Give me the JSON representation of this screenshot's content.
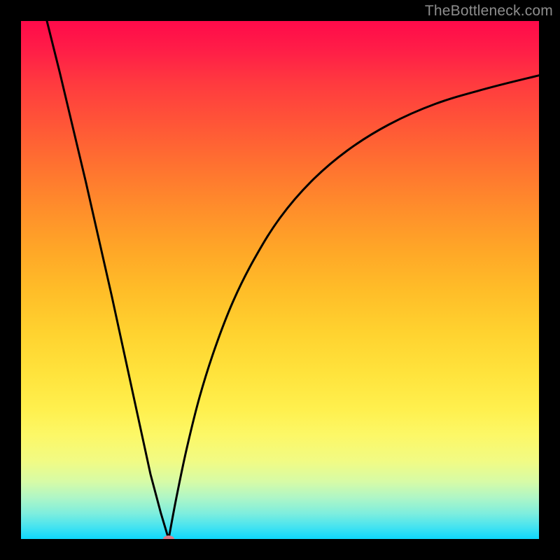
{
  "watermark": "TheBottleneck.com",
  "chart_data": {
    "type": "line",
    "title": "",
    "xlabel": "",
    "ylabel": "",
    "xlim": [
      0,
      1
    ],
    "ylim": [
      0,
      1
    ],
    "minimum": {
      "x": 0.285,
      "y": 0.0
    },
    "left_branch": {
      "x": [
        0.05,
        0.075,
        0.1,
        0.125,
        0.15,
        0.175,
        0.2,
        0.225,
        0.25,
        0.27,
        0.285
      ],
      "y": [
        1.0,
        0.9,
        0.795,
        0.69,
        0.58,
        0.47,
        0.355,
        0.24,
        0.125,
        0.05,
        0.0
      ]
    },
    "right_branch": {
      "x": [
        0.285,
        0.3,
        0.32,
        0.345,
        0.375,
        0.41,
        0.45,
        0.5,
        0.56,
        0.63,
        0.71,
        0.8,
        0.9,
        1.0
      ],
      "y": [
        0.0,
        0.08,
        0.175,
        0.275,
        0.37,
        0.46,
        0.54,
        0.62,
        0.69,
        0.75,
        0.8,
        0.84,
        0.87,
        0.895
      ]
    },
    "gradient_stops": [
      {
        "pos": 0.0,
        "color": "#ff0a4a"
      },
      {
        "pos": 0.2,
        "color": "#ff5637"
      },
      {
        "pos": 0.44,
        "color": "#ffa627"
      },
      {
        "pos": 0.68,
        "color": "#ffe33c"
      },
      {
        "pos": 0.85,
        "color": "#f1fb84"
      },
      {
        "pos": 0.95,
        "color": "#7feedd"
      },
      {
        "pos": 1.0,
        "color": "#0ed7fd"
      }
    ]
  }
}
